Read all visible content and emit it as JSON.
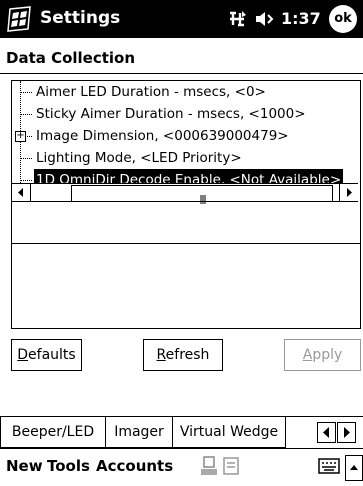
{
  "titlebar": {
    "title": "Settings",
    "time": "1:37",
    "ok_label": "ok",
    "icons": [
      "start-flag-icon",
      "connectivity-icon",
      "volume-icon"
    ]
  },
  "page": {
    "heading": "Data Collection"
  },
  "tree": {
    "items": [
      {
        "text": "Aimer LED Duration - msecs, <0>",
        "expandable": false,
        "selected": false
      },
      {
        "text": "Sticky Aimer Duration - msecs, <1000>",
        "expandable": false,
        "selected": false
      },
      {
        "text": "Image Dimension, <000639000479>",
        "expandable": true,
        "selected": false
      },
      {
        "text": "Lighting Mode, <LED Priority>",
        "expandable": false,
        "selected": false
      },
      {
        "text": "1D OmniDir Decode Enable, <Not Available>",
        "expandable": false,
        "selected": true
      }
    ]
  },
  "buttons": {
    "defaults": "Defaults",
    "refresh": "Refresh",
    "apply": "Apply"
  },
  "tabs": [
    {
      "label": "Beeper/LED",
      "active": false
    },
    {
      "label": "Imager",
      "active": true
    },
    {
      "label": "Virtual Wedge",
      "active": false
    }
  ],
  "menubar": {
    "items": [
      "New",
      "Tools",
      "Accounts"
    ]
  }
}
